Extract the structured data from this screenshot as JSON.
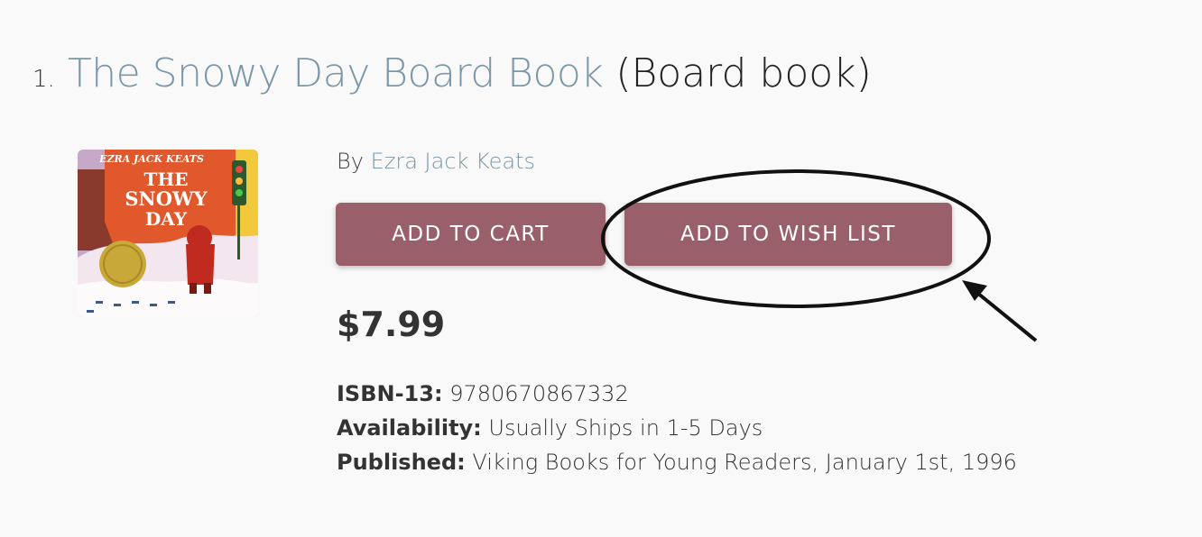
{
  "result": {
    "number": "1.",
    "title": "The Snowy Day Board Book",
    "format": "(Board book)",
    "byline_prefix": "By",
    "author": "Ezra Jack Keats",
    "add_to_cart_label": "ADD TO CART",
    "add_to_wish_list_label": "ADD TO WISH LIST",
    "price": "$7.99",
    "details": [
      {
        "label": "ISBN-13:",
        "value": "9780670867332"
      },
      {
        "label": "Availability:",
        "value": "Usually Ships in 1-5 Days"
      },
      {
        "label": "Published:",
        "value": "Viking Books for Young Readers, January 1st, 1996"
      }
    ],
    "cover": {
      "author_text": "EZRA JACK KEATS",
      "title_line1": "THE",
      "title_line2": "SNOWY",
      "title_line3": "DAY"
    }
  },
  "colors": {
    "button": "#99606c",
    "link": "#7b97a8",
    "background": "#f9f9f9"
  }
}
